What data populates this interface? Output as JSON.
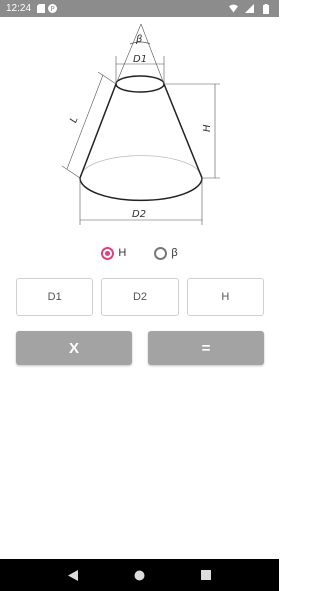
{
  "status_bar": {
    "time": "12:24"
  },
  "diagram": {
    "labels": {
      "beta": "β",
      "d1": "D1",
      "d2": "D2",
      "h": "H",
      "l": "L"
    }
  },
  "mode": {
    "options": [
      {
        "label": "H",
        "selected": true
      },
      {
        "label": "β",
        "selected": false
      }
    ]
  },
  "inputs": {
    "d1_placeholder": "D1",
    "d2_placeholder": "D2",
    "h_placeholder": "H"
  },
  "actions": {
    "clear_label": "X",
    "calc_label": "="
  },
  "colors": {
    "accent": "#e0407b",
    "button_bg": "#a3a3a3",
    "status_bar": "#8c8c8c"
  }
}
